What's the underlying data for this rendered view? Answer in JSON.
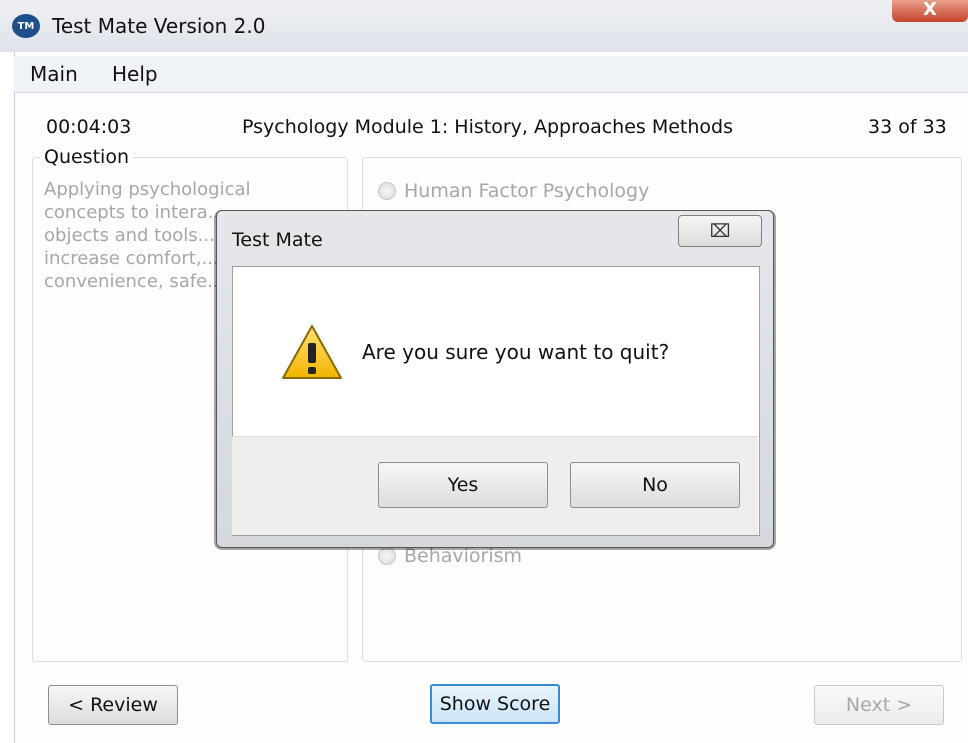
{
  "window": {
    "title": "Test Mate Version 2.0",
    "app_icon_text": "TM",
    "close_glyph": "X"
  },
  "menu": {
    "items": [
      "Main",
      "Help"
    ]
  },
  "header": {
    "timer": "00:04:03",
    "module": "Psychology Module 1: History, Approaches  Methods",
    "progress": "33 of 33"
  },
  "question": {
    "legend": "Question",
    "text": "Applying psychological concepts to intera... objects and tools... increase comfort,... convenience, safe..."
  },
  "answers": [
    {
      "label": "Human Factor Psychology"
    },
    {
      "label": "Behaviorism"
    }
  ],
  "buttons": {
    "review": "< Review",
    "show_score": "Show Score",
    "next": "Next >"
  },
  "dialog": {
    "title": "Test Mate",
    "close_glyph": "⌧",
    "message": "Are you sure you want to quit?",
    "yes": "Yes",
    "no": "No"
  }
}
